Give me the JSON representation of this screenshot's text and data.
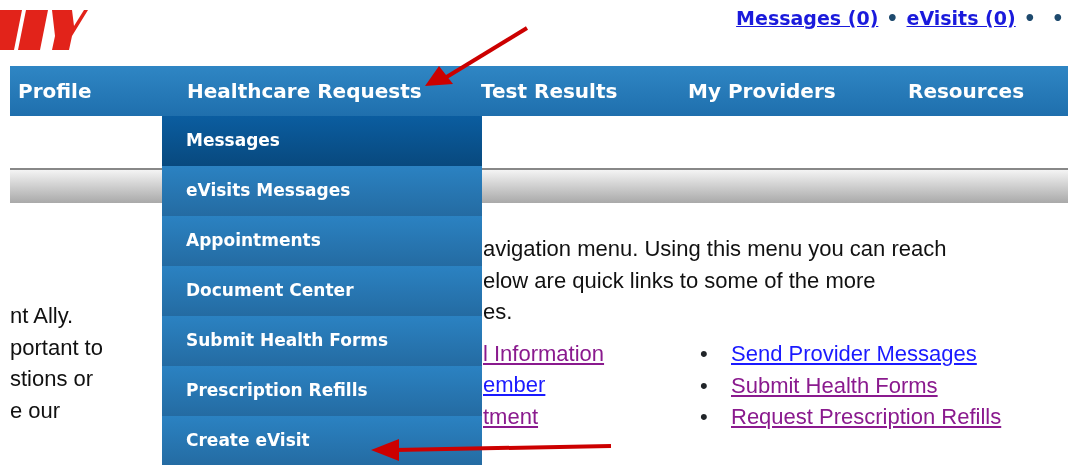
{
  "header_links": [
    {
      "label": "Messages (0)"
    },
    {
      "label": "eVisits (0)"
    }
  ],
  "header_separators": [
    "•",
    "•",
    "•"
  ],
  "nav": [
    {
      "label": "Profile"
    },
    {
      "label": "Healthcare Requests"
    },
    {
      "label": "Test Results"
    },
    {
      "label": "My Providers"
    },
    {
      "label": "Resources"
    }
  ],
  "dropdown": [
    {
      "label": "Messages",
      "selected": true
    },
    {
      "label": "eVisits Messages",
      "selected": false
    },
    {
      "label": "Appointments",
      "selected": false
    },
    {
      "label": "Document Center",
      "selected": false
    },
    {
      "label": "Submit Health Forms",
      "selected": false
    },
    {
      "label": "Prescription Refills",
      "selected": false
    },
    {
      "label": "Create eVisit",
      "selected": false
    }
  ],
  "left_text": [
    "nt Ally.",
    "portant to",
    "stions or",
    "e our"
  ],
  "intro_text": [
    "avigation menu. Using this menu you can reach",
    "elow are quick links to some of the more",
    "es."
  ],
  "quick_links_left": [
    {
      "label": "l Information",
      "visited": true
    },
    {
      "label": "ember",
      "visited": false
    },
    {
      "label": "tment",
      "visited": true
    }
  ],
  "quick_links_right": [
    {
      "label": "Send Provider Messages",
      "visited": false
    },
    {
      "label": "Submit Health Forms",
      "visited": true
    },
    {
      "label": "Request Prescription Refills",
      "visited": true
    }
  ],
  "bullet": "•"
}
